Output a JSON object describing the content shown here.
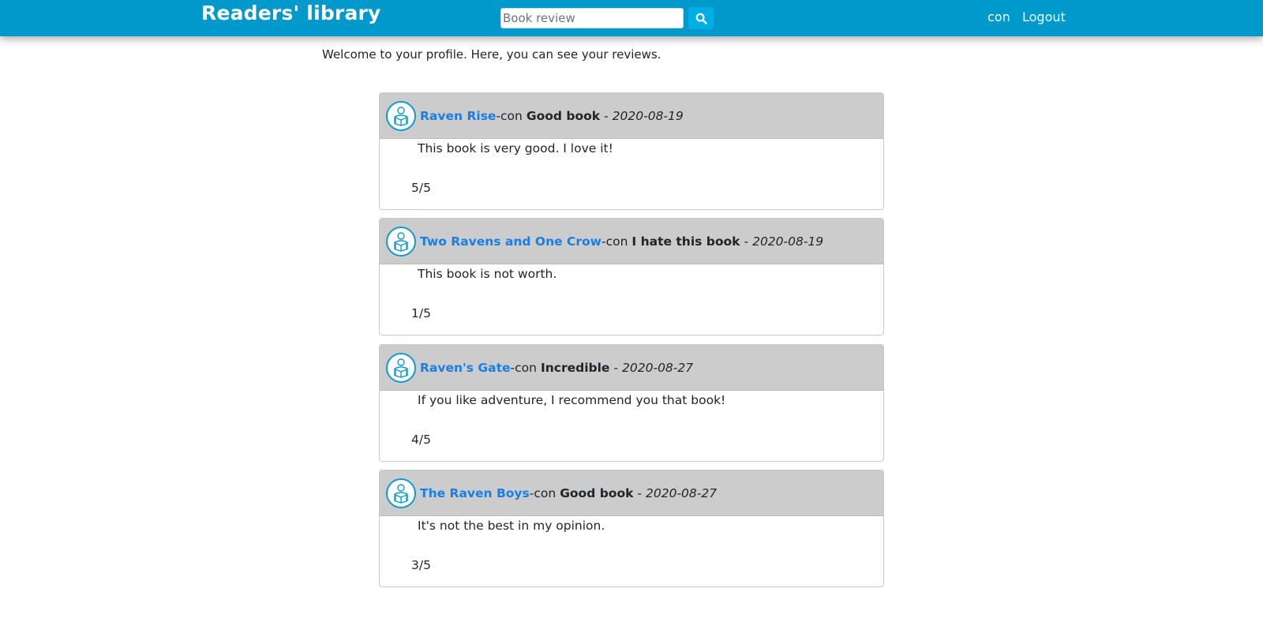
{
  "nav": {
    "brand": "Readers' library",
    "search_placeholder": "Book review",
    "search_icon": "magnifier-icon",
    "user_link": "con",
    "logout_link": "Logout"
  },
  "welcome_text": "Welcome to your profile. Here, you can see your reviews.",
  "colors": {
    "navbar": "#0099cc",
    "search_button": "#00aee6",
    "card_header": "#cccccc",
    "book_link": "#1a7ee6"
  },
  "reviews": [
    {
      "avatar_icon": "reader-avatar-icon",
      "book": "Raven Rise",
      "user": "-con",
      "title": "Good book",
      "separator": "-",
      "date": "2020-08-19",
      "text": "This book is very good. I love it!",
      "rating": "5/5"
    },
    {
      "avatar_icon": "reader-avatar-icon",
      "book": "Two Ravens and One Crow",
      "user": "-con",
      "title": "I hate this book",
      "separator": "-",
      "date": "2020-08-19",
      "text": "This book is not worth.",
      "rating": "1/5"
    },
    {
      "avatar_icon": "reader-avatar-icon",
      "book": "Raven's Gate",
      "user": "-con",
      "title": "Incredible",
      "separator": "-",
      "date": "2020-08-27",
      "text": "If you like adventure, I recommend you that book!",
      "rating": "4/5"
    },
    {
      "avatar_icon": "reader-avatar-icon",
      "book": "The Raven Boys",
      "user": "-con",
      "title": "Good book",
      "separator": "-",
      "date": "2020-08-27",
      "text": "It's not the best in my opinion.",
      "rating": "3/5"
    }
  ]
}
